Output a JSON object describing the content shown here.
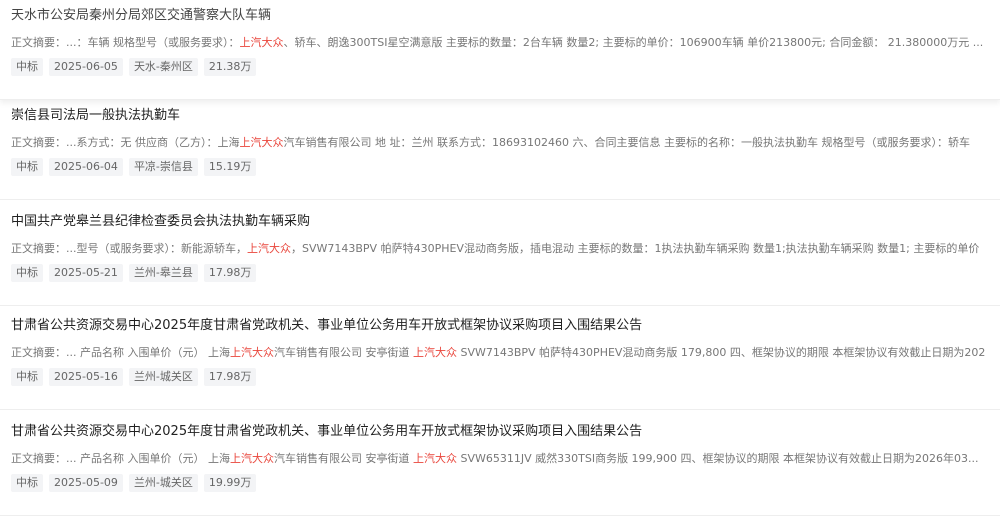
{
  "summary_prefix": "正文摘要：",
  "items": [
    {
      "title": "天水市公安局秦州分局郊区交通警察大队车辆",
      "summary": [
        {
          "t": "...：车辆 规格型号（或服务要求）：",
          "h": false
        },
        {
          "t": "上汽大众",
          "h": true
        },
        {
          "t": "、轿车、朗逸300TSI星空满意版 主要标的数量：2台车辆 数量2; 主要标的单价：106900车辆 单价213800元; 合同金额： 21.380000万元 ...",
          "h": false
        }
      ],
      "tags": [
        "中标",
        "2025-06-05",
        "天水-秦州区",
        "21.38万"
      ]
    },
    {
      "title": "崇信县司法局一般执法执勤车",
      "summary": [
        {
          "t": "...系方式：无 供应商（乙方）：上海",
          "h": false
        },
        {
          "t": "上汽大众",
          "h": true
        },
        {
          "t": "汽车销售有限公司 地 址：兰州 联系方式：18693102460 六、合同主要信息 主要标的名称：一般执法执勤车 规格型号（或服务要求）：轿车",
          "h": false
        }
      ],
      "tags": [
        "中标",
        "2025-06-04",
        "平凉-崇信县",
        "15.19万"
      ]
    },
    {
      "title": "中国共产党皋兰县纪律检查委员会执法执勤车辆采购",
      "summary": [
        {
          "t": "...型号（或服务要求）：新能源轿车，",
          "h": false
        },
        {
          "t": "上汽大众",
          "h": true
        },
        {
          "t": "，SVW7143BPV 帕萨特430PHEV混动商务版，插电混动 主要标的数量：1执法执勤车辆采购 数量1;执法执勤车辆采购 数量1; 主要标的单价",
          "h": false
        }
      ],
      "tags": [
        "中标",
        "2025-05-21",
        "兰州-皋兰县",
        "17.98万"
      ]
    },
    {
      "title": "甘肃省公共资源交易中心2025年度甘肃省党政机关、事业单位公务用车开放式框架协议采购项目入围结果公告",
      "summary": [
        {
          "t": "... 产品名称 入围单价（元） 上海",
          "h": false
        },
        {
          "t": "上汽大众",
          "h": true
        },
        {
          "t": "汽车销售有限公司 安亭街道 ",
          "h": false
        },
        {
          "t": "上汽大众",
          "h": true
        },
        {
          "t": " SVW7143BPV 帕萨特430PHEV混动商务版 179,800 四、框架协议的期限 本框架协议有效截止日期为202",
          "h": false
        }
      ],
      "tags": [
        "中标",
        "2025-05-16",
        "兰州-城关区",
        "17.98万"
      ]
    },
    {
      "title": "甘肃省公共资源交易中心2025年度甘肃省党政机关、事业单位公务用车开放式框架协议采购项目入围结果公告",
      "summary": [
        {
          "t": "... 产品名称 入围单价（元） 上海",
          "h": false
        },
        {
          "t": "上汽大众",
          "h": true
        },
        {
          "t": "汽车销售有限公司 安亭街道 ",
          "h": false
        },
        {
          "t": "上汽大众",
          "h": true
        },
        {
          "t": " SVW65311JV 威然330TSI商务版 199,900 四、框架协议的期限 本框架协议有效截止日期为2026年03...",
          "h": false
        }
      ],
      "tags": [
        "中标",
        "2025-05-09",
        "兰州-城关区",
        "19.99万"
      ]
    }
  ],
  "colors": {
    "highlight": "#e9463c",
    "tag_bg": "#f3f4f6",
    "summary_text": "#777777",
    "title_text": "#222222"
  }
}
